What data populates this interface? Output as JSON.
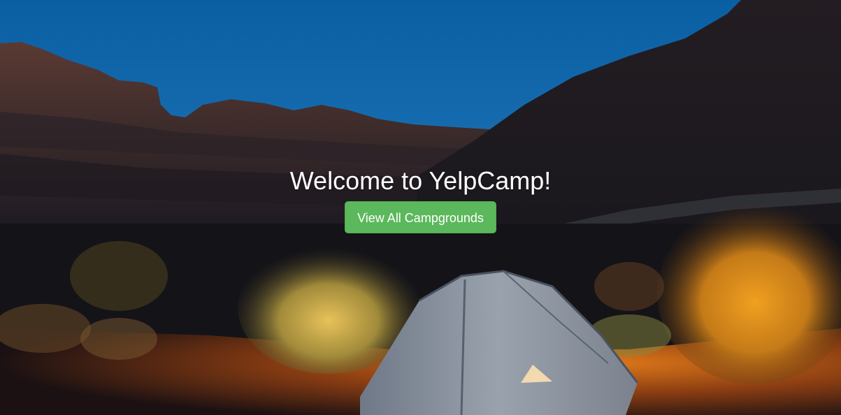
{
  "landing": {
    "title": "Welcome to YelpCamp!",
    "cta_label": "View All Campgrounds"
  },
  "colors": {
    "cta_background": "#5cb85c",
    "title_text": "#ffffff",
    "sky_top": "#0a5fa3",
    "sky_bottom": "#2f86c9"
  },
  "background": {
    "scene": "desert canyon at dusk with a lit tent among glowing shrubs"
  }
}
